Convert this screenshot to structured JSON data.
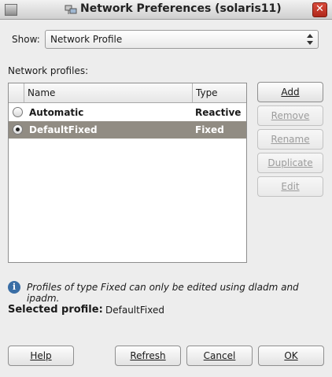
{
  "window": {
    "title": "Network Preferences (solaris11)",
    "close_glyph": "✕"
  },
  "show": {
    "label": "Show:",
    "value": "Network Profile"
  },
  "profiles_label": "Network profiles:",
  "table": {
    "columns": [
      "Name",
      "Type"
    ],
    "rows": [
      {
        "name": "Automatic",
        "type": "Reactive",
        "selected": false
      },
      {
        "name": "DefaultFixed",
        "type": "Fixed",
        "selected": true
      }
    ]
  },
  "side_buttons": {
    "add": "Add",
    "remove": "Remove",
    "rename": "Rename",
    "duplicate": "Duplicate",
    "edit": "Edit"
  },
  "info": {
    "icon": "info-icon",
    "glyph": "i",
    "text": "Profiles of type Fixed can only be edited using dladm and ipadm."
  },
  "selected_profile": {
    "label": "Selected profile:",
    "value": "DefaultFixed"
  },
  "footer_buttons": {
    "help": "Help",
    "refresh": "Refresh",
    "cancel": "Cancel",
    "ok": "OK"
  },
  "colors": {
    "selection": "#918c83",
    "info_icon": "#3a6ea5",
    "close_button": "#c23a2b"
  }
}
